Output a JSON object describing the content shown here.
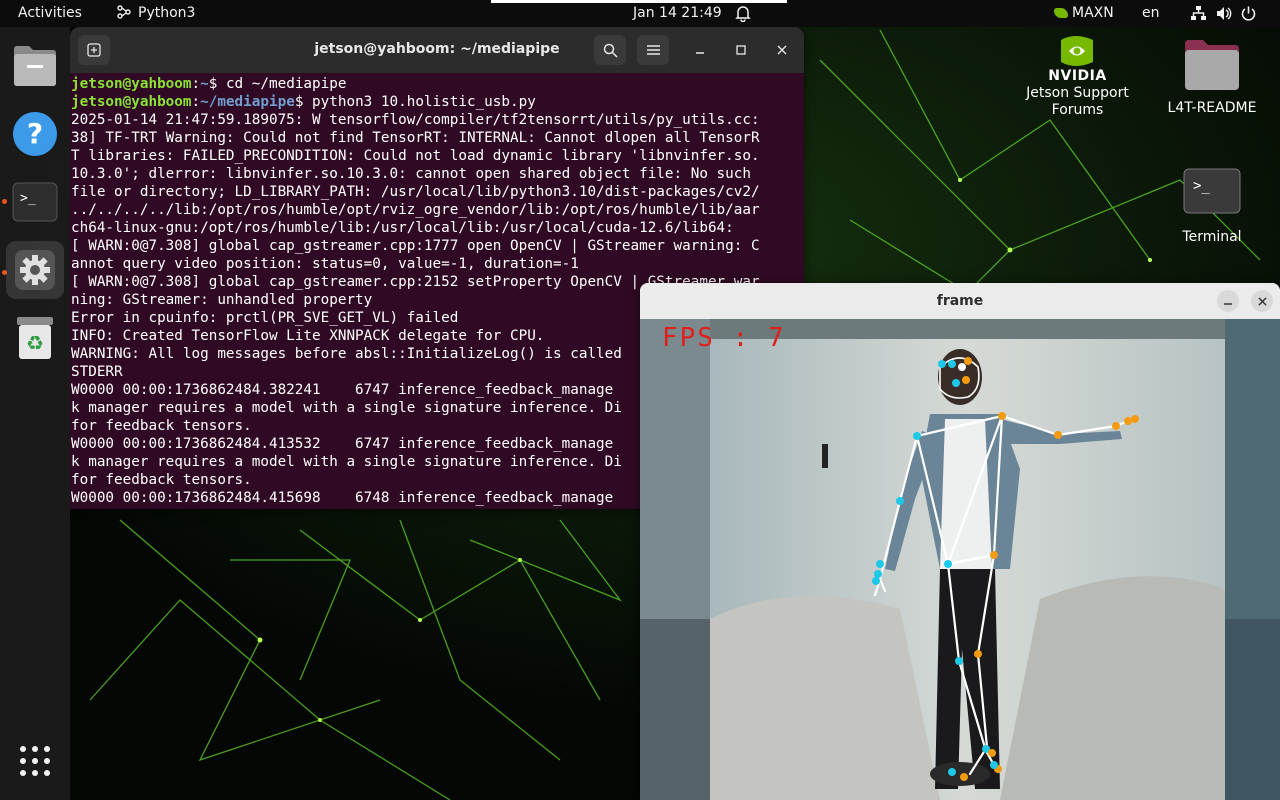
{
  "topbar": {
    "activities": "Activities",
    "app_name": "Python3",
    "clock": "Jan 14  21:49",
    "power_mode": "MAXN",
    "language": "en"
  },
  "dock": {
    "items": [
      "Files",
      "Help",
      "Terminal",
      "Settings",
      "Trash",
      "Show Applications"
    ]
  },
  "terminal": {
    "title": "jetson@yahboom: ~/mediapipe",
    "prompt_user": "jetson@yahboom",
    "prompt_path_1": "~",
    "command_1": "cd ~/mediapipe",
    "prompt_path_2": "~/mediapipe",
    "command_2": "python3 10.holistic_usb.py",
    "output": [
      "2025-01-14 21:47:59.189075: W tensorflow/compiler/tf2tensorrt/utils/py_utils.cc:",
      "38] TF-TRT Warning: Could not find TensorRT: INTERNAL: Cannot dlopen all TensorR",
      "T libraries: FAILED_PRECONDITION: Could not load dynamic library 'libnvinfer.so.",
      "10.3.0'; dlerror: libnvinfer.so.10.3.0: cannot open shared object file: No such",
      "file or directory; LD_LIBRARY_PATH: /usr/local/lib/python3.10/dist-packages/cv2/",
      "../../../../lib:/opt/ros/humble/opt/rviz_ogre_vendor/lib:/opt/ros/humble/lib/aar",
      "ch64-linux-gnu:/opt/ros/humble/lib:/usr/local/lib:/usr/local/cuda-12.6/lib64:",
      "[ WARN:0@7.308] global cap_gstreamer.cpp:1777 open OpenCV | GStreamer warning: C",
      "annot query video position: status=0, value=-1, duration=-1",
      "[ WARN:0@7.308] global cap_gstreamer.cpp:2152 setProperty OpenCV | GStreamer war",
      "ning: GStreamer: unhandled property",
      "Error in cpuinfo: prctl(PR_SVE_GET_VL) failed",
      "INFO: Created TensorFlow Lite XNNPACK delegate for CPU.",
      "WARNING: All log messages before absl::InitializeLog() is called",
      "STDERR",
      "W0000 00:00:1736862484.382241    6747 inference_feedback_manage",
      "k manager requires a model with a single signature inference. Di",
      "for feedback tensors.",
      "W0000 00:00:1736862484.413532    6747 inference_feedback_manage",
      "k manager requires a model with a single signature inference. Di",
      "for feedback tensors.",
      "W0000 00:00:1736862484.415698    6748 inference_feedback_manage"
    ]
  },
  "desktop_icons": {
    "nvidia_brand": "NVIDIA",
    "nvidia_label_1": "Jetson Support",
    "nvidia_label_2": "Forums",
    "readme_label": "L4T-README",
    "terminal_label": "Terminal"
  },
  "frame_window": {
    "title": "frame",
    "fps_text": "FPS : 7"
  },
  "colors": {
    "terminal_bg": "#300a24",
    "prompt_user": "#8ae234",
    "prompt_path": "#729fcf",
    "landmark_left": "#f39c12",
    "landmark_right": "#1ec8e6",
    "skeleton": "#ffffff",
    "fps_text": "#e0201a",
    "ubuntu_accent": "#e95420",
    "nvidia_green": "#76b900"
  }
}
